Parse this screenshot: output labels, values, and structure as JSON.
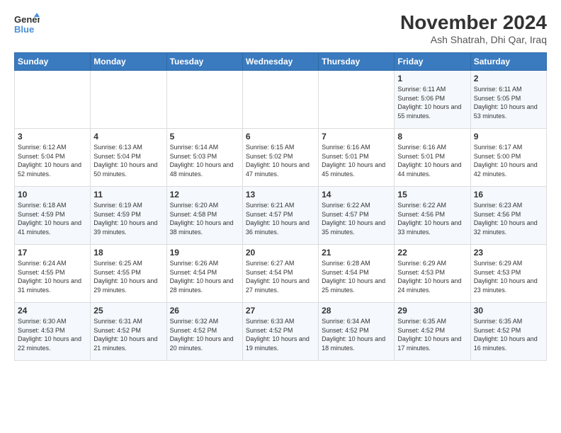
{
  "logo": {
    "line1": "General",
    "line2": "Blue"
  },
  "title": "November 2024",
  "subtitle": "Ash Shatrah, Dhi Qar, Iraq",
  "headers": [
    "Sunday",
    "Monday",
    "Tuesday",
    "Wednesday",
    "Thursday",
    "Friday",
    "Saturday"
  ],
  "weeks": [
    [
      {
        "day": "",
        "info": ""
      },
      {
        "day": "",
        "info": ""
      },
      {
        "day": "",
        "info": ""
      },
      {
        "day": "",
        "info": ""
      },
      {
        "day": "",
        "info": ""
      },
      {
        "day": "1",
        "info": "Sunrise: 6:11 AM\nSunset: 5:06 PM\nDaylight: 10 hours\nand 55 minutes."
      },
      {
        "day": "2",
        "info": "Sunrise: 6:11 AM\nSunset: 5:05 PM\nDaylight: 10 hours\nand 53 minutes."
      }
    ],
    [
      {
        "day": "3",
        "info": "Sunrise: 6:12 AM\nSunset: 5:04 PM\nDaylight: 10 hours\nand 52 minutes."
      },
      {
        "day": "4",
        "info": "Sunrise: 6:13 AM\nSunset: 5:04 PM\nDaylight: 10 hours\nand 50 minutes."
      },
      {
        "day": "5",
        "info": "Sunrise: 6:14 AM\nSunset: 5:03 PM\nDaylight: 10 hours\nand 48 minutes."
      },
      {
        "day": "6",
        "info": "Sunrise: 6:15 AM\nSunset: 5:02 PM\nDaylight: 10 hours\nand 47 minutes."
      },
      {
        "day": "7",
        "info": "Sunrise: 6:16 AM\nSunset: 5:01 PM\nDaylight: 10 hours\nand 45 minutes."
      },
      {
        "day": "8",
        "info": "Sunrise: 6:16 AM\nSunset: 5:01 PM\nDaylight: 10 hours\nand 44 minutes."
      },
      {
        "day": "9",
        "info": "Sunrise: 6:17 AM\nSunset: 5:00 PM\nDaylight: 10 hours\nand 42 minutes."
      }
    ],
    [
      {
        "day": "10",
        "info": "Sunrise: 6:18 AM\nSunset: 4:59 PM\nDaylight: 10 hours\nand 41 minutes."
      },
      {
        "day": "11",
        "info": "Sunrise: 6:19 AM\nSunset: 4:59 PM\nDaylight: 10 hours\nand 39 minutes."
      },
      {
        "day": "12",
        "info": "Sunrise: 6:20 AM\nSunset: 4:58 PM\nDaylight: 10 hours\nand 38 minutes."
      },
      {
        "day": "13",
        "info": "Sunrise: 6:21 AM\nSunset: 4:57 PM\nDaylight: 10 hours\nand 36 minutes."
      },
      {
        "day": "14",
        "info": "Sunrise: 6:22 AM\nSunset: 4:57 PM\nDaylight: 10 hours\nand 35 minutes."
      },
      {
        "day": "15",
        "info": "Sunrise: 6:22 AM\nSunset: 4:56 PM\nDaylight: 10 hours\nand 33 minutes."
      },
      {
        "day": "16",
        "info": "Sunrise: 6:23 AM\nSunset: 4:56 PM\nDaylight: 10 hours\nand 32 minutes."
      }
    ],
    [
      {
        "day": "17",
        "info": "Sunrise: 6:24 AM\nSunset: 4:55 PM\nDaylight: 10 hours\nand 31 minutes."
      },
      {
        "day": "18",
        "info": "Sunrise: 6:25 AM\nSunset: 4:55 PM\nDaylight: 10 hours\nand 29 minutes."
      },
      {
        "day": "19",
        "info": "Sunrise: 6:26 AM\nSunset: 4:54 PM\nDaylight: 10 hours\nand 28 minutes."
      },
      {
        "day": "20",
        "info": "Sunrise: 6:27 AM\nSunset: 4:54 PM\nDaylight: 10 hours\nand 27 minutes."
      },
      {
        "day": "21",
        "info": "Sunrise: 6:28 AM\nSunset: 4:54 PM\nDaylight: 10 hours\nand 25 minutes."
      },
      {
        "day": "22",
        "info": "Sunrise: 6:29 AM\nSunset: 4:53 PM\nDaylight: 10 hours\nand 24 minutes."
      },
      {
        "day": "23",
        "info": "Sunrise: 6:29 AM\nSunset: 4:53 PM\nDaylight: 10 hours\nand 23 minutes."
      }
    ],
    [
      {
        "day": "24",
        "info": "Sunrise: 6:30 AM\nSunset: 4:53 PM\nDaylight: 10 hours\nand 22 minutes."
      },
      {
        "day": "25",
        "info": "Sunrise: 6:31 AM\nSunset: 4:52 PM\nDaylight: 10 hours\nand 21 minutes."
      },
      {
        "day": "26",
        "info": "Sunrise: 6:32 AM\nSunset: 4:52 PM\nDaylight: 10 hours\nand 20 minutes."
      },
      {
        "day": "27",
        "info": "Sunrise: 6:33 AM\nSunset: 4:52 PM\nDaylight: 10 hours\nand 19 minutes."
      },
      {
        "day": "28",
        "info": "Sunrise: 6:34 AM\nSunset: 4:52 PM\nDaylight: 10 hours\nand 18 minutes."
      },
      {
        "day": "29",
        "info": "Sunrise: 6:35 AM\nSunset: 4:52 PM\nDaylight: 10 hours\nand 17 minutes."
      },
      {
        "day": "30",
        "info": "Sunrise: 6:35 AM\nSunset: 4:52 PM\nDaylight: 10 hours\nand 16 minutes."
      }
    ]
  ]
}
